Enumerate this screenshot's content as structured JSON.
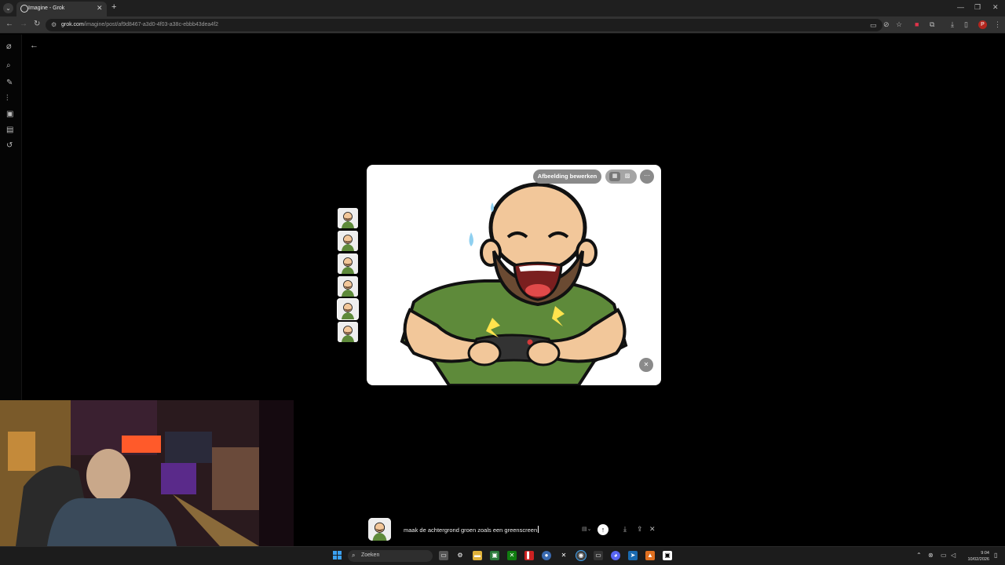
{
  "browser": {
    "tab_title": "Imagine - Grok",
    "url_host": "grok.com",
    "url_path": "/imagine/post/af9d8467-a3d0-4f03-a38c-ebbb43dea4f2",
    "profile_initial": "P"
  },
  "card": {
    "edit_label": "Afbeelding bewerken",
    "more_label": "···"
  },
  "prompt": {
    "text": "maak de achtergrond groen zoals een greenscreen"
  },
  "taskbar": {
    "search_placeholder": "Zoeken",
    "time": "9:04",
    "date": "10/02/2026"
  },
  "colors": {
    "accent": "#3aa0f0",
    "shirt": "#5e8a3a",
    "skin": "#f2c79a"
  }
}
